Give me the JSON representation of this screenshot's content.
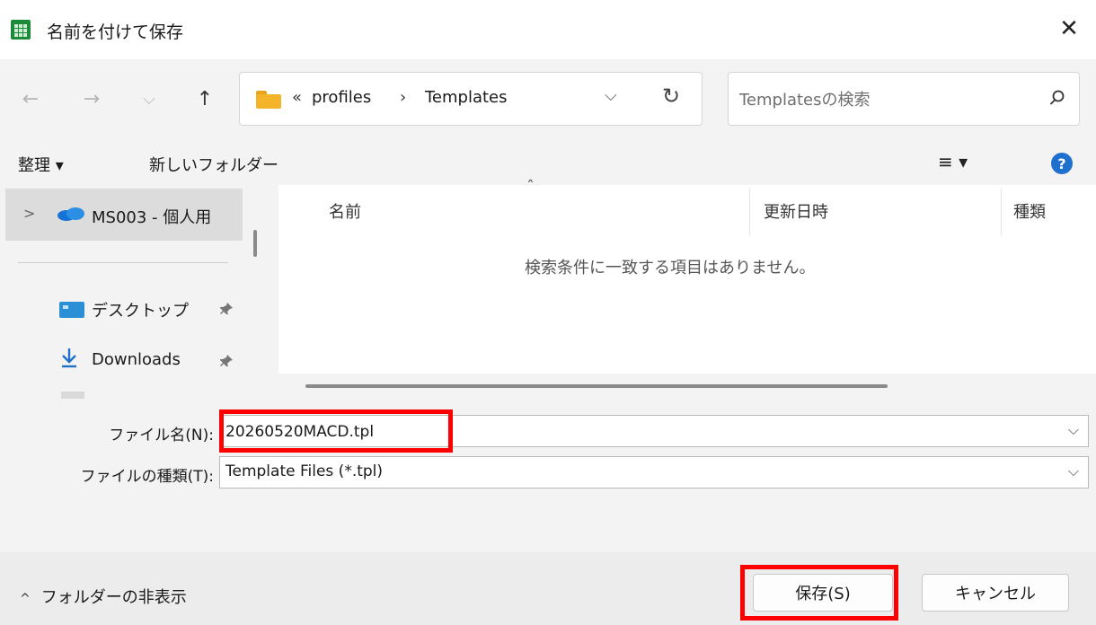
{
  "window": {
    "title": "名前を付けて保存",
    "close_glyph": "✕"
  },
  "nav": {
    "back_glyph": "←",
    "forward_glyph": "→",
    "recent_glyph": "⌵",
    "up_glyph": "↑",
    "breadcrumb_overflow": "«",
    "breadcrumb": [
      "profiles",
      "Templates"
    ],
    "breadcrumb_separator": "›",
    "dropdown_glyph": "⌵",
    "refresh_glyph": "↻",
    "search_placeholder": "Templatesの検索"
  },
  "toolbar": {
    "organize": "整理 ▾",
    "new_folder": "新しいフォルダー",
    "view_glyph": "≡ ▾",
    "help_glyph": "?"
  },
  "navpane": {
    "expander_glyph": ">",
    "onedrive": "MS003 - 個人用",
    "items": [
      {
        "label": "デスクトップ",
        "icon": "desktop-icon",
        "pinned": true
      },
      {
        "label": "Downloads",
        "icon": "download-icon",
        "pinned": true
      }
    ],
    "pin_glyph": "📌"
  },
  "filelist": {
    "columns": [
      "名前",
      "更新日時",
      "種類"
    ],
    "sort_glyph": "ˆ",
    "empty_message": "検索条件に一致する項目はありません。"
  },
  "form": {
    "filename_label": "ファイル名(N):",
    "filename_value": "20260520MACD.tpl",
    "filetype_label": "ファイルの種類(T):",
    "filetype_value": "Template Files (*.tpl)",
    "dropdown_glyph": "⌵"
  },
  "footer": {
    "hide_folders": "フォルダーの非表示",
    "hide_chevron": "^",
    "save_label": "保存(S)",
    "cancel_label": "キャンセル"
  },
  "colors": {
    "highlight": "#ff0000",
    "app_icon": "#1d8a3a",
    "folder": "#f4b429",
    "accent": "#1f6fcf"
  }
}
